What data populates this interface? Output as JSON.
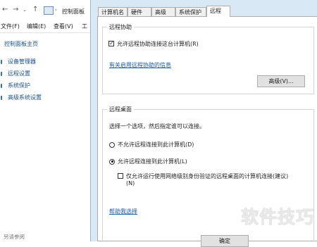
{
  "background_window": {
    "address": {
      "path": "控制面板"
    },
    "menu": [
      "文件(F)",
      "编辑(E)",
      "查看(V)",
      "工"
    ],
    "home_link": "控制面板主页",
    "links": [
      "设备管理器",
      "远程设置",
      "系统保护",
      "高级系统设置"
    ],
    "see_also": "另请参阅"
  },
  "dialog": {
    "tabs": [
      "计算机名",
      "硬件",
      "高级",
      "系统保护",
      "远程"
    ],
    "active_tab": "远程",
    "remote_assistance": {
      "title": "远程协助",
      "allow_checkbox": {
        "label": "允许远程协助连接这台计算机(R)",
        "checked": true
      },
      "info_link": "有关启用远程协助的信息",
      "advanced_button": "高级(V)..."
    },
    "remote_desktop": {
      "title": "远程桌面",
      "instruction": "选择一个选项，然后指定谁可以连接。",
      "option_deny": {
        "label": "不允许远程连接到此计算机(D)",
        "selected": false
      },
      "option_allow": {
        "label": "允许远程连接到此计算机(L)",
        "selected": true
      },
      "nla_checkbox": {
        "label_line1": "仅允许运行使用网络级别身份验证的远程桌面的计算机连接(建议)",
        "label_line2": "(N)",
        "checked": false
      },
      "help_link": "帮助我选择"
    },
    "ok_button": "确定"
  },
  "watermark": "软件技巧"
}
